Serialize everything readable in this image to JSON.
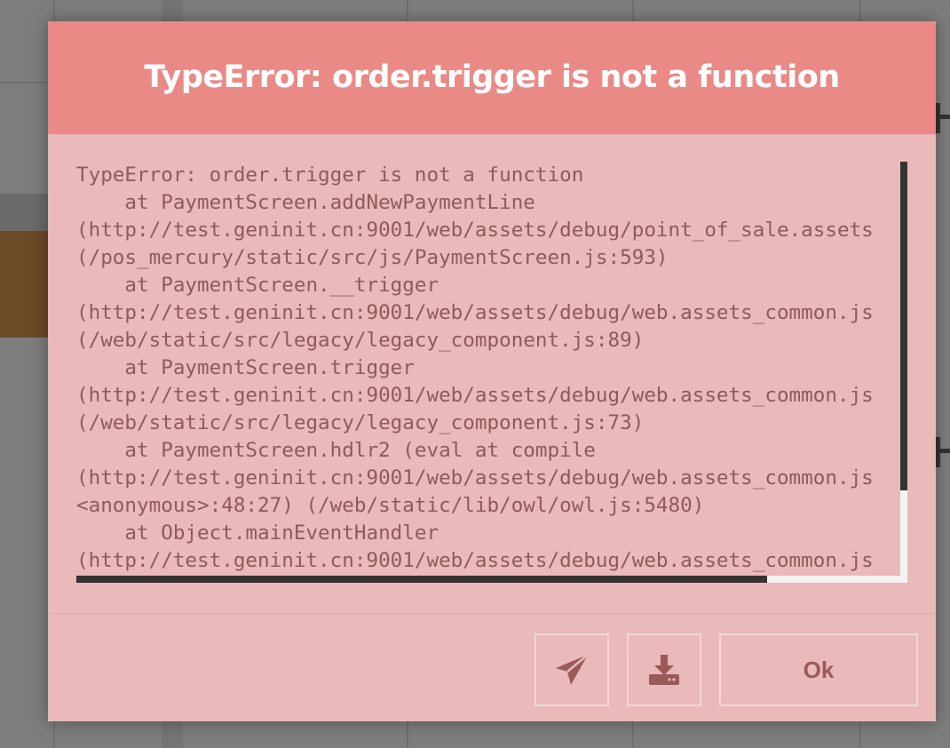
{
  "dialog": {
    "title": "TypeError: order.trigger is not a function",
    "traceback": "TypeError: order.trigger is not a function\n    at PaymentScreen.addNewPaymentLine\n(http://test.geninit.cn:9001/web/assets/debug/point_of_sale.assets\n(/pos_mercury/static/src/js/PaymentScreen.js:593)\n    at PaymentScreen.__trigger\n(http://test.geninit.cn:9001/web/assets/debug/web.assets_common.js\n(/web/static/src/legacy/legacy_component.js:89)\n    at PaymentScreen.trigger\n(http://test.geninit.cn:9001/web/assets/debug/web.assets_common.js\n(/web/static/src/legacy/legacy_component.js:73)\n    at PaymentScreen.hdlr2 (eval at compile\n(http://test.geninit.cn:9001/web/assets/debug/web.assets_common.js\n<anonymous>:48:27) (/web/static/lib/owl/owl.js:5480)\n    at Object.mainEventHandler\n(http://test.geninit.cn:9001/web/assets/debug/web.assets_common.js",
    "buttons": {
      "send_icon": "paper-plane-icon",
      "download_icon": "download-icon",
      "ok_label": "Ok"
    }
  },
  "colors": {
    "header_bg": "#ea8a86",
    "body_bg": "#eab9b9",
    "title_text": "#ffffff",
    "trace_text": "#8f5a5a",
    "button_text": "#9a5a5a",
    "scrollbar_thumb": "#333333"
  }
}
